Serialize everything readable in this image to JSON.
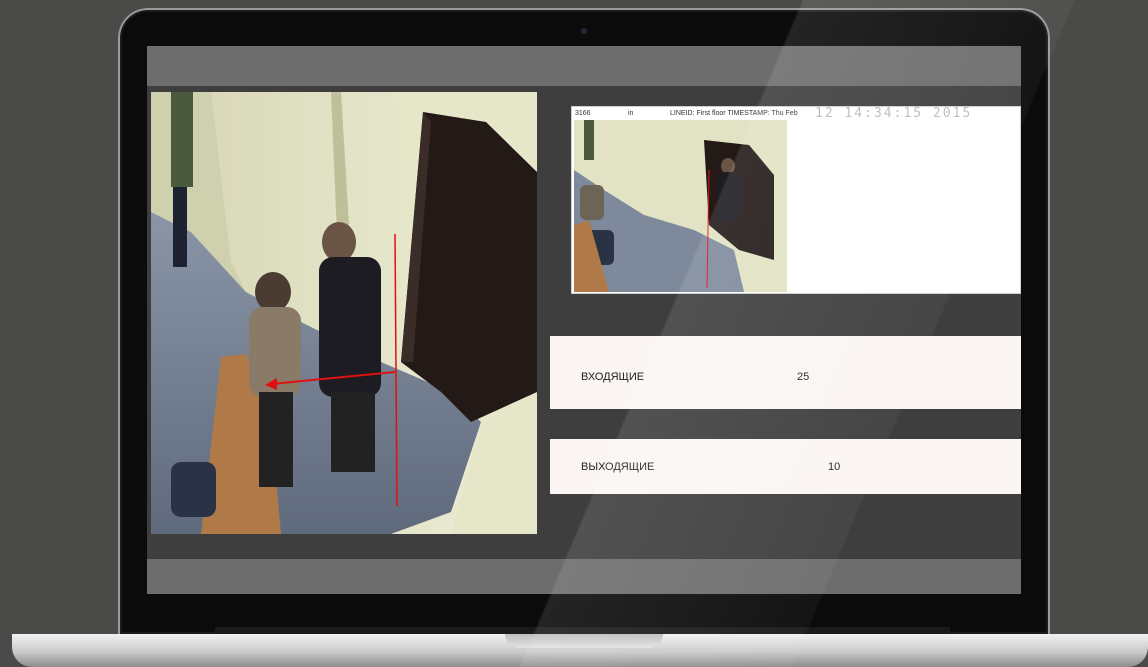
{
  "thumbnail": {
    "header_id": "3166",
    "header_direction": "in",
    "header_line": "LINEID: First floor TIMESTAMP: Thu Feb",
    "header_timestamp": "12 14:34:15 2015"
  },
  "counters": {
    "incoming_label": "ВХОДЯЩИЕ",
    "incoming_value": "25",
    "outgoing_label": "ВЫХОДЯЩИЕ",
    "outgoing_value": "10"
  },
  "colors": {
    "tripwire": "#e01010",
    "panel_bg": "#fbf6f4",
    "screen_bar": "#6d6d6d"
  }
}
